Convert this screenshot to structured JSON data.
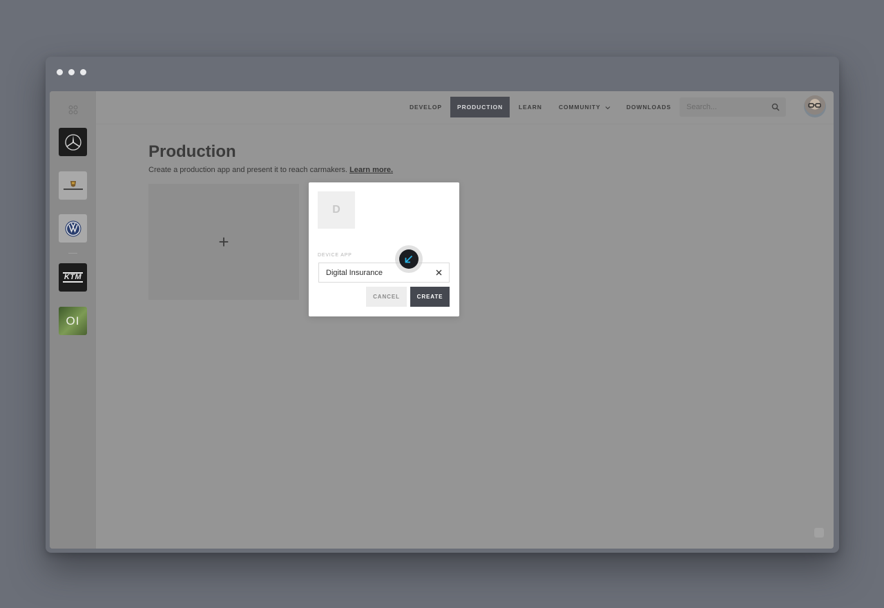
{
  "sidebar": {
    "brands": [
      {
        "name": "Mercedes-Benz",
        "icon": "mercedes-star-icon"
      },
      {
        "name": "Porsche",
        "icon": "porsche-crest-icon"
      },
      {
        "name": "Volkswagen",
        "icon": "vw-logo-icon"
      },
      {
        "name": "KTM",
        "icon": "ktm-logo-icon",
        "label": "KTM"
      },
      {
        "name": "OI",
        "icon": "oi-logo-icon",
        "label": "OI"
      }
    ]
  },
  "nav": {
    "items": [
      {
        "label": "DEVELOP"
      },
      {
        "label": "PRODUCTION",
        "active": true
      },
      {
        "label": "LEARN"
      },
      {
        "label": "COMMUNITY",
        "has_dropdown": true
      },
      {
        "label": "DOWNLOADS"
      }
    ],
    "search_placeholder": "Search...",
    "active_color": "#494b52"
  },
  "page": {
    "title": "Production",
    "subtitle": "Create a production app and present it to reach carmakers.",
    "learn_more": "Learn more.",
    "add_card_symbol": "+"
  },
  "modal": {
    "thumb_letter": "D",
    "field_label": "DEVICE APP",
    "field_value": "Digital Insurance",
    "cancel_label": "CANCEL",
    "create_label": "CREATE",
    "cursor_accent": "#29b6e8"
  }
}
